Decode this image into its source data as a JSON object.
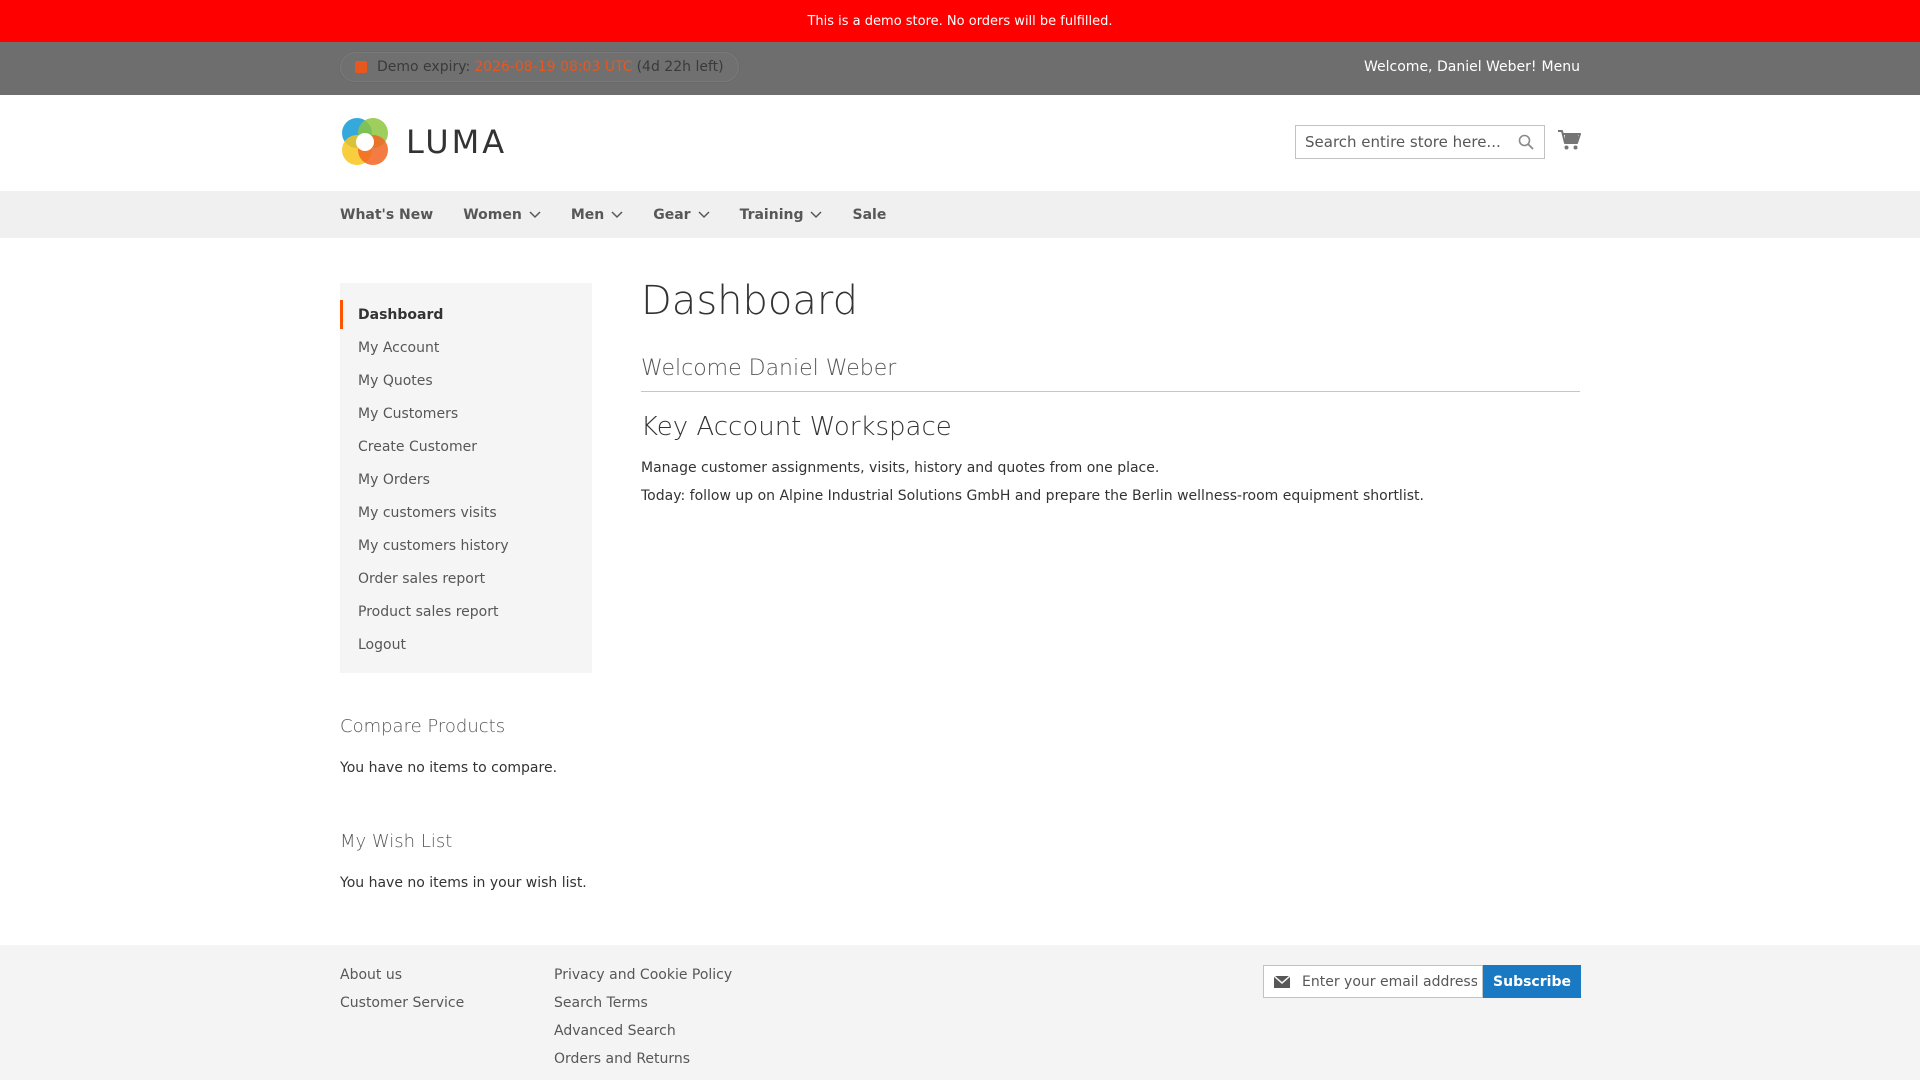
{
  "notice": {
    "text": "This is a demo store. No orders will be fulfilled."
  },
  "panel": {
    "expiry_label": "Demo expiry:",
    "expiry_date": "2026-08-19 08:03 UTC",
    "expiry_left": "(4d 22h left)",
    "welcome": "Welcome, Daniel Weber!",
    "menu": "Menu"
  },
  "header": {
    "logo_text": "LUMA",
    "search_placeholder": "Search entire store here..."
  },
  "nav": {
    "items": [
      {
        "label": "What's New",
        "has_dropdown": false
      },
      {
        "label": "Women",
        "has_dropdown": true
      },
      {
        "label": "Men",
        "has_dropdown": true
      },
      {
        "label": "Gear",
        "has_dropdown": true
      },
      {
        "label": "Training",
        "has_dropdown": true
      },
      {
        "label": "Sale",
        "has_dropdown": false
      }
    ]
  },
  "sidebar": {
    "items": [
      {
        "label": "Dashboard",
        "active": true
      },
      {
        "label": "My Account"
      },
      {
        "label": "My Quotes"
      },
      {
        "label": "My Customers"
      },
      {
        "label": "Create Customer"
      },
      {
        "label": "My Orders"
      },
      {
        "label": "My customers visits"
      },
      {
        "label": "My customers history"
      },
      {
        "label": "Order sales report"
      },
      {
        "label": "Product sales report"
      },
      {
        "label": "Logout"
      }
    ]
  },
  "compare": {
    "title": "Compare Products",
    "text": "You have no items to compare."
  },
  "wishlist": {
    "title": "My Wish List",
    "text": "You have no items in your wish list."
  },
  "main": {
    "title": "Dashboard",
    "welcome": "Welcome Daniel Weber",
    "workspace_title": "Key Account Workspace",
    "paragraph1": "Manage customer assignments, visits, history and quotes from one place.",
    "paragraph2": "Today: follow up on Alpine Industrial Solutions GmbH and prepare the Berlin wellness-room equipment shortlist."
  },
  "footer": {
    "col1": [
      "About us",
      "Customer Service"
    ],
    "col2": [
      "Privacy and Cookie Policy",
      "Search Terms",
      "Advanced Search",
      "Orders and Returns"
    ],
    "newsletter_placeholder": "Enter your email address",
    "subscribe_label": "Subscribe"
  },
  "colors": {
    "notice_bg": "#ff0000",
    "panel_bg": "#6e6e6e",
    "accent_orange": "#ff5501",
    "subscribe_blue": "#1979c3"
  },
  "icons": [
    "square-icon",
    "search-icon",
    "cart-icon",
    "chevron-down-icon",
    "envelope-icon",
    "luma-logo-icon"
  ]
}
